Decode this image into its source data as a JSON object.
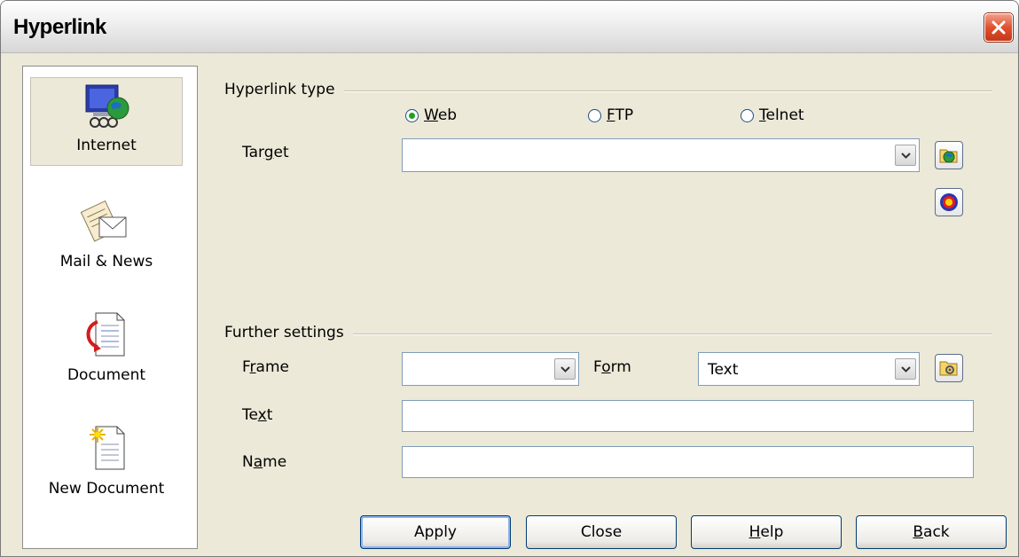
{
  "window": {
    "title": "Hyperlink"
  },
  "sidebar": {
    "items": [
      {
        "label": "Internet",
        "icon": "internet-globe-icon",
        "selected": true
      },
      {
        "label": "Mail & News",
        "icon": "mail-news-icon",
        "selected": false
      },
      {
        "label": "Document",
        "icon": "document-icon",
        "selected": false
      },
      {
        "label": "New Document",
        "icon": "new-document-icon",
        "selected": false
      }
    ]
  },
  "hyperlink_type": {
    "group_label": "Hyperlink type",
    "options": [
      {
        "pre": "",
        "key": "W",
        "post": "eb",
        "checked": true
      },
      {
        "pre": "",
        "key": "F",
        "post": "TP",
        "checked": false
      },
      {
        "pre": "",
        "key": "T",
        "post": "elnet",
        "checked": false
      }
    ],
    "target": {
      "pre": "Tar",
      "key": "g",
      "post": "et",
      "value": ""
    }
  },
  "further": {
    "group_label": "Further settings",
    "frame": {
      "pre": "F",
      "key": "r",
      "post": "ame",
      "value": ""
    },
    "form": {
      "pre": "F",
      "key": "o",
      "post": "rm",
      "value": "Text"
    },
    "text": {
      "pre": "Te",
      "key": "x",
      "post": "t",
      "value": ""
    },
    "name": {
      "pre": "N",
      "key": "a",
      "post": "me",
      "value": ""
    }
  },
  "buttons": [
    {
      "pre": "Apply",
      "key": "",
      "post": ""
    },
    {
      "pre": "Close",
      "key": "",
      "post": ""
    },
    {
      "pre": "",
      "key": "H",
      "post": "elp"
    },
    {
      "pre": "",
      "key": "B",
      "post": "ack"
    }
  ]
}
